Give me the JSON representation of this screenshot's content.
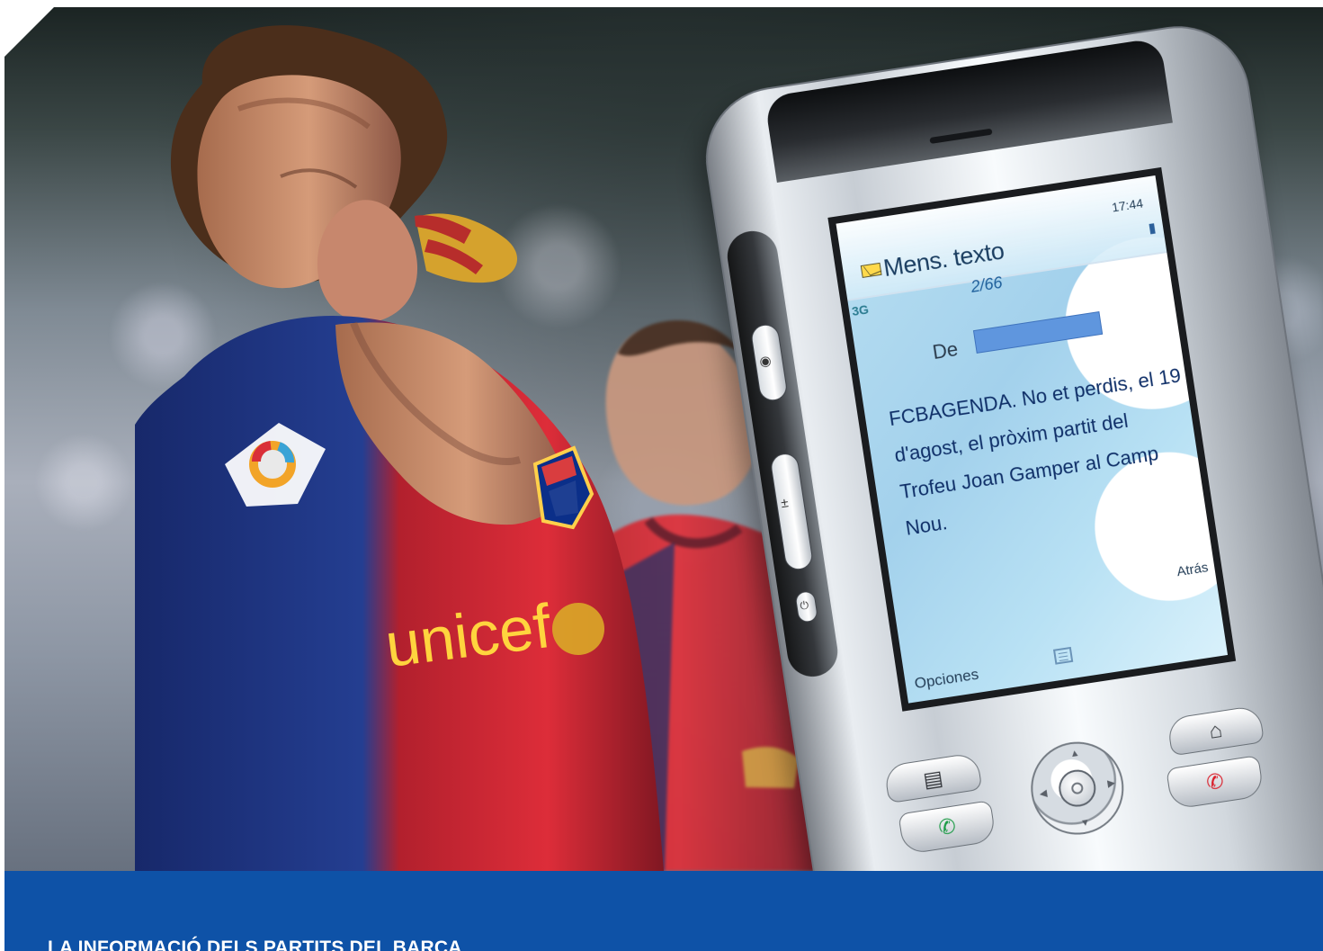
{
  "photo": {
    "description_icons": [
      "football-player-icon",
      "football-player-background-icon",
      "mobile-phone-icon"
    ]
  },
  "phone": {
    "screen_title": "Mens. texto",
    "time": "17:44",
    "counter": "2/66",
    "network_indicator": "3G",
    "from_label": "De",
    "message": "FCBAGENDA. No et perdis, el 19 d'agost, el pròxim partit del Trofeu Joan Gamper al Camp Nou.",
    "left_softkey": "Opciones",
    "right_softkey": "Atrás"
  },
  "caption": {
    "text": "LA INFORMACIÓ DELS PARTITS DEL BARÇA"
  },
  "colors": {
    "caption_band": "#0e52a7",
    "caption_text": "#ffffff",
    "screen_text": "#0f2f68"
  }
}
